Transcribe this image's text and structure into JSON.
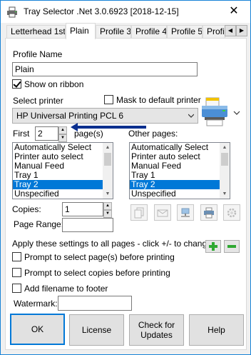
{
  "window": {
    "title": "Tray Selector .Net 3.0.6923 [2018-12-15]",
    "close_glyph": "✕"
  },
  "tabs": [
    {
      "label": "Letterhead 1st"
    },
    {
      "label": "Plain",
      "active": true
    },
    {
      "label": "Profile 3"
    },
    {
      "label": "Profile 4"
    },
    {
      "label": "Profile 5"
    },
    {
      "label": "Profi"
    }
  ],
  "profile": {
    "name_label": "Profile Name",
    "name_value": "Plain",
    "show_on_ribbon_label": "Show on ribbon",
    "show_on_ribbon_checked": true
  },
  "printer": {
    "select_label": "Select printer",
    "mask_label": "Mask to default printer",
    "mask_checked": false,
    "selected": "HP Universal Printing PCL 6"
  },
  "first": {
    "label": "First",
    "value": "2",
    "unit": "page(s)",
    "items": [
      "Automatically Select",
      "Printer auto select",
      "Manual Feed",
      "Tray 1",
      "Tray 2",
      "Unspecified"
    ],
    "selected_index": 4
  },
  "other": {
    "label": "Other pages:",
    "items": [
      "Automatically Select",
      "Printer auto select",
      "Manual Feed",
      "Tray 1",
      "Tray 2",
      "Unspecified"
    ],
    "selected_index": 4
  },
  "copies": {
    "label": "Copies:",
    "value": "1"
  },
  "page_range": {
    "label": "Page Range:",
    "value": ""
  },
  "apply": {
    "label": "Apply these settings to all pages - click +/- to change"
  },
  "options": {
    "prompt_pages_label": "Prompt to select page(s) before printing",
    "prompt_copies_label": "Prompt to select copies before printing",
    "add_filename_label": "Add filename to footer"
  },
  "watermark": {
    "label": "Watermark:",
    "value": ""
  },
  "buttons": {
    "ok": "OK",
    "license": "License",
    "check_updates_line1": "Check for",
    "check_updates_line2": "Updates",
    "help": "Help"
  },
  "colors": {
    "accent": "#0078d7",
    "arrow": "#0a2f8f",
    "plus_green": "#2fa832"
  }
}
